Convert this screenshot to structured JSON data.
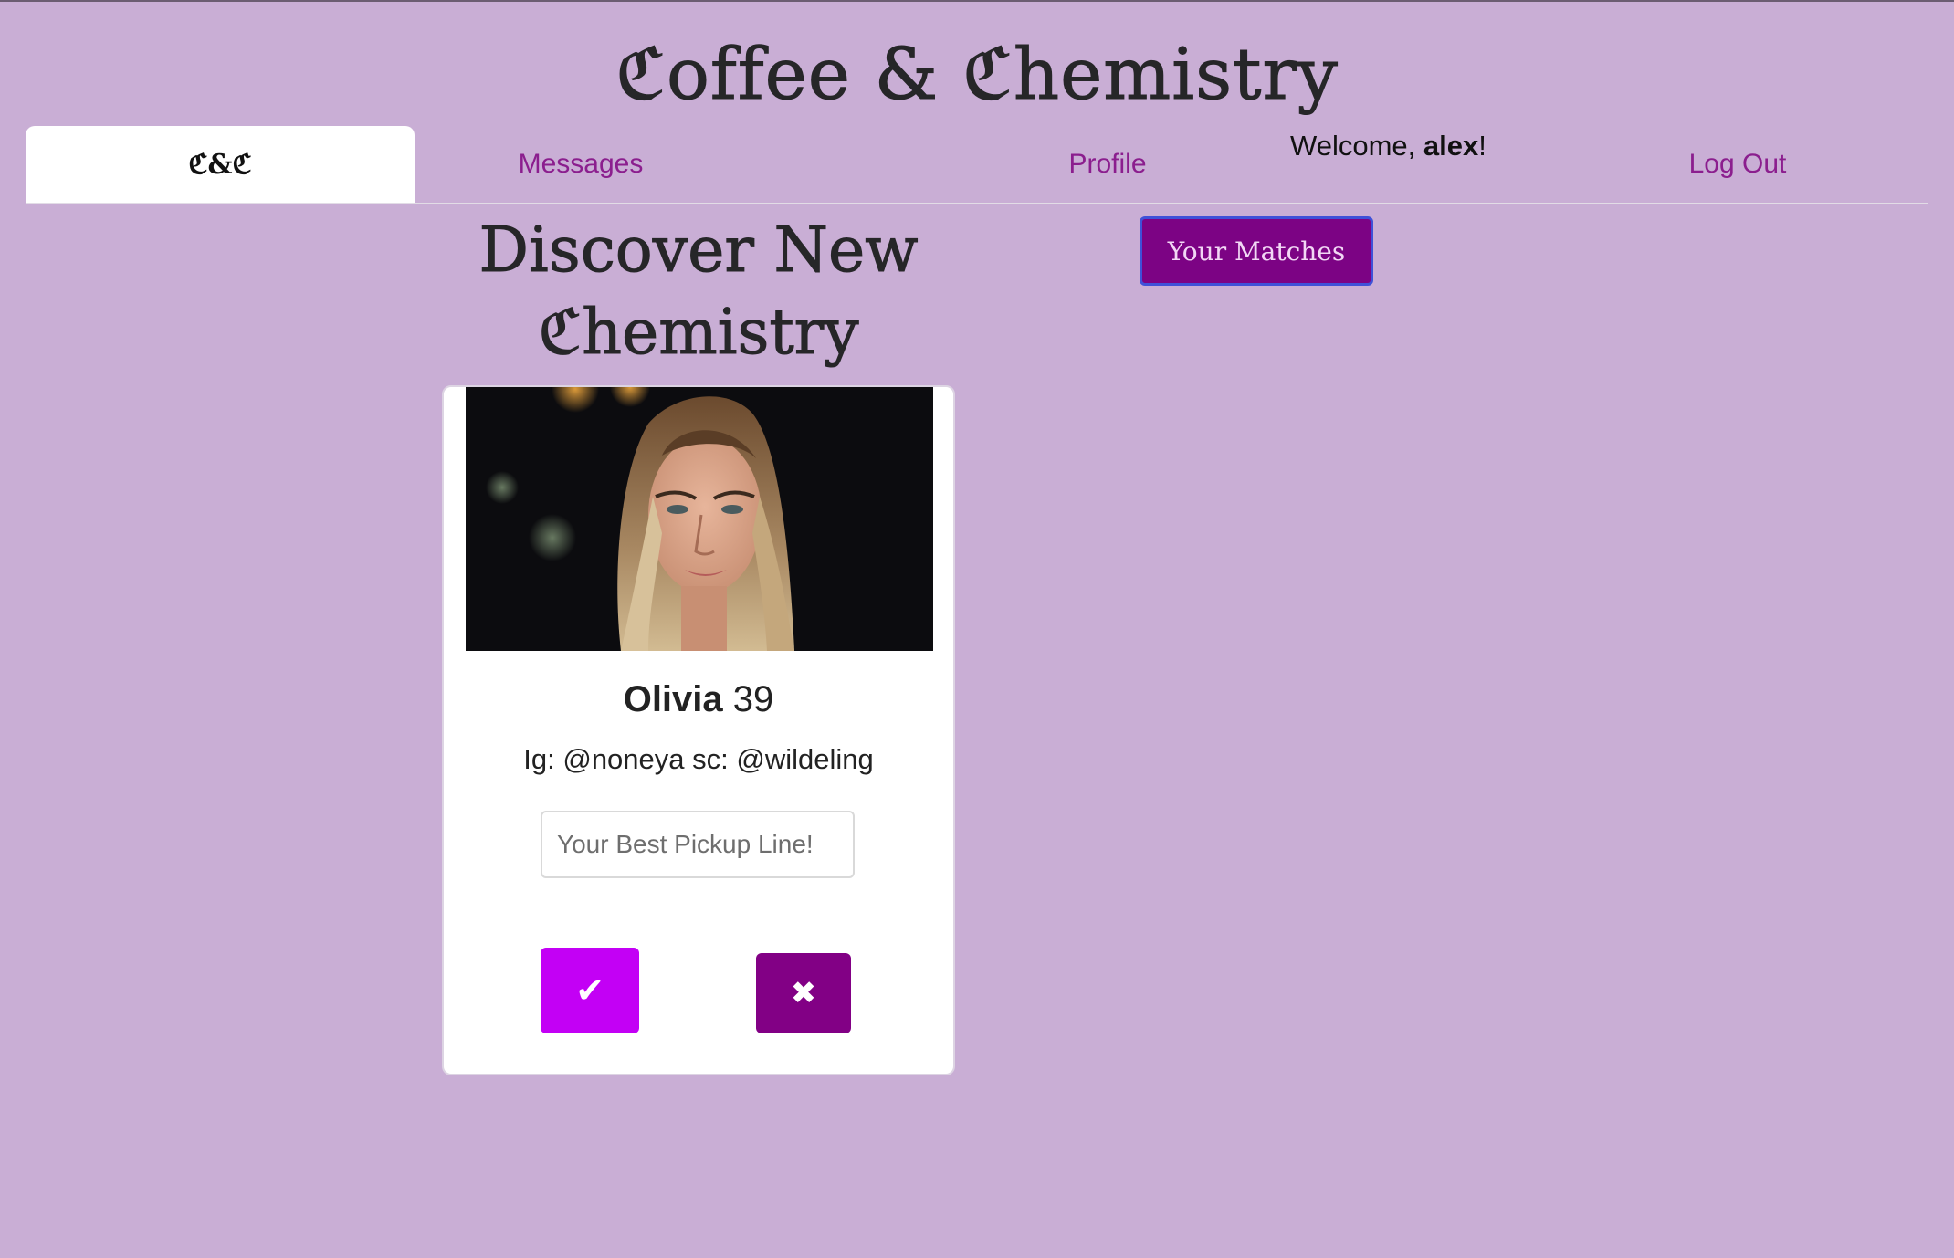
{
  "site": {
    "title": "ℭoffee & ℭhemistry"
  },
  "nav": {
    "tabs": [
      {
        "label": "ℭ&ℭ",
        "active": true
      },
      {
        "label": "Messages",
        "active": false
      },
      {
        "label": "Profile",
        "active": false
      },
      {
        "label": "Log Out",
        "active": false
      }
    ],
    "welcome_prefix": "Welcome, ",
    "username": "alex",
    "welcome_suffix": "!"
  },
  "discover": {
    "heading": "Discover New ℭhemistry",
    "matches_button": "Your Matches"
  },
  "card": {
    "photo_icon": "profile-photo",
    "name": "Olivia",
    "age": "39",
    "handles": "Ig: @noneya sc: @wildeling",
    "pickup_placeholder": "Your Best Pickup Line!",
    "like_symbol": "✔",
    "pass_symbol": "✖"
  },
  "colors": {
    "background": "#c9aed5",
    "link": "#8b1e8e",
    "like": "#c300f5",
    "pass": "#820085",
    "matches_button": "#7c0384"
  }
}
